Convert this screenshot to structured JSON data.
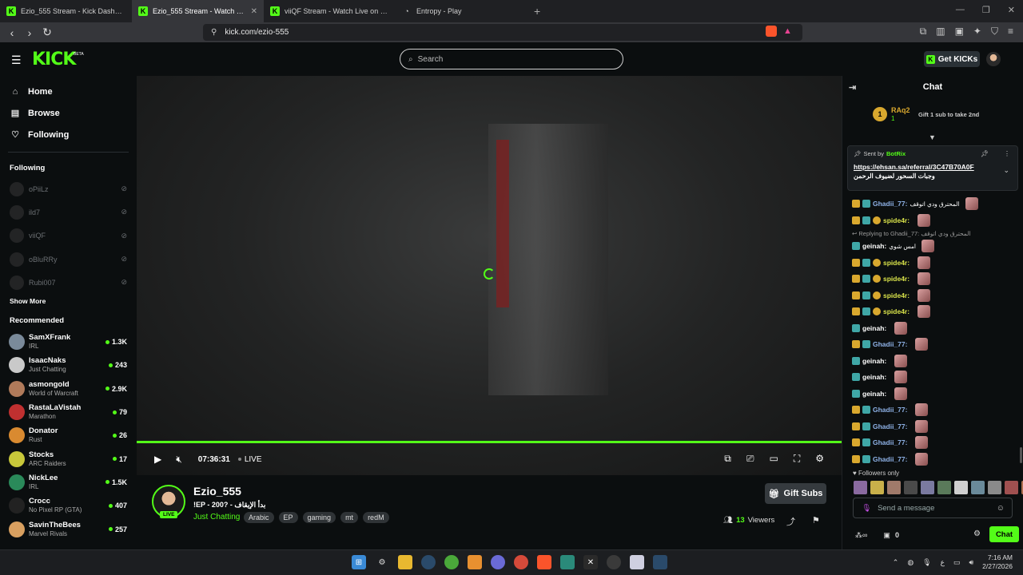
{
  "browser": {
    "tabs": [
      {
        "title": "Ezio_555 Stream - Kick Dashboard",
        "active": false,
        "icon": "kick-icon"
      },
      {
        "title": "Ezio_555 Stream - Watch Live on Kick",
        "active": true,
        "icon": "kick-icon"
      },
      {
        "title": "viiQF Stream - Watch Live on Kick",
        "active": false,
        "icon": "kick-icon"
      },
      {
        "title": "Entropy - Play",
        "active": false,
        "icon": "entropy-icon"
      }
    ],
    "url": "kick.com/ezio-555"
  },
  "header": {
    "logo": "KICK",
    "beta": "BETA",
    "search_placeholder": "Search",
    "get_kicks": "Get KICKs"
  },
  "sidebar": {
    "nav": [
      {
        "label": "Home",
        "icon": "home-icon"
      },
      {
        "label": "Browse",
        "icon": "browse-icon"
      },
      {
        "label": "Following",
        "icon": "heart-icon"
      }
    ],
    "following_title": "Following",
    "following": [
      {
        "name": "oPiiLz"
      },
      {
        "name": "ild7"
      },
      {
        "name": "viiQF"
      },
      {
        "name": "oBluRRy"
      },
      {
        "name": "Rubi007"
      }
    ],
    "show_more": "Show More",
    "recommended_title": "Recommended",
    "recommended": [
      {
        "name": "SamXFrank",
        "category": "IRL",
        "viewers": "1.3K",
        "color": "#7a8a9a"
      },
      {
        "name": "IsaacNaks",
        "category": "Just Chatting",
        "viewers": "243",
        "color": "#c9c9c9"
      },
      {
        "name": "asmongold",
        "category": "World of Warcraft",
        "viewers": "2.9K",
        "color": "#b07a5a"
      },
      {
        "name": "RastaLaVistah",
        "category": "Marathon",
        "viewers": "79",
        "color": "#c03030"
      },
      {
        "name": "Donator",
        "category": "Rust",
        "viewers": "26",
        "color": "#d98a30"
      },
      {
        "name": "Stocks",
        "category": "ARC Raiders",
        "viewers": "17",
        "color": "#c8c83a"
      },
      {
        "name": "NickLee",
        "category": "IRL",
        "viewers": "1.5K",
        "color": "#2a8a5a"
      },
      {
        "name": "Crocc",
        "category": "No Pixel RP (GTA)",
        "viewers": "407",
        "color": "#222222"
      },
      {
        "name": "SavinTheBees",
        "category": "Marvel Rivals",
        "viewers": "257",
        "color": "#d9a060"
      }
    ]
  },
  "player": {
    "time": "07:36:31",
    "live": "LIVE"
  },
  "stream": {
    "channel": "Ezio_555",
    "live_badge": "LIVE",
    "title": "!EP - 200? - بدأ الإيقاف",
    "category": "Just Chatting",
    "tags": [
      "Arabic",
      "EP",
      "gaming",
      "mt",
      "redM"
    ],
    "gift_subs": "Gift Subs",
    "viewers_count": "13",
    "viewers_label": "Viewers"
  },
  "chat": {
    "title": "Chat",
    "leader_name": "RAq2",
    "leader_count": "1",
    "leader_rank": "1",
    "gift_prompt": "Gift 1 sub to take 2nd",
    "pinned": {
      "sent_by": "Sent by",
      "bot": "BotRix",
      "link": "https://ehsan.sa/referral/3C47B70A0F",
      "text": "وجبات السحور لضيوف الرحمن"
    },
    "messages": [
      {
        "user": "Ghadii_77:",
        "color": "#8fb3e8",
        "badges": [
          "crown",
          "sub"
        ],
        "text": "المحترق ودي اتوقف"
      },
      {
        "user": "spide4r:",
        "color": "#d9e34a",
        "badges": [
          "crown",
          "sub",
          "gold"
        ],
        "text": ""
      },
      {
        "reply": "Replying to Ghadii_77: المحترق ودي اتوقف"
      },
      {
        "user": "geinah:",
        "color": "#ffffff",
        "badges": [
          "sub"
        ],
        "text": "امس شوي"
      },
      {
        "user": "spide4r:",
        "color": "#d9e34a",
        "badges": [
          "crown",
          "sub",
          "gold"
        ],
        "text": ""
      },
      {
        "user": "spide4r:",
        "color": "#d9e34a",
        "badges": [
          "crown",
          "sub",
          "gold"
        ],
        "text": ""
      },
      {
        "user": "spide4r:",
        "color": "#d9e34a",
        "badges": [
          "crown",
          "sub",
          "gold"
        ],
        "text": ""
      },
      {
        "user": "spide4r:",
        "color": "#d9e34a",
        "badges": [
          "crown",
          "sub",
          "gold"
        ],
        "text": ""
      },
      {
        "user": "geinah:",
        "color": "#ffffff",
        "badges": [
          "sub"
        ],
        "text": ""
      },
      {
        "user": "Ghadii_77:",
        "color": "#8fb3e8",
        "badges": [
          "crown",
          "sub"
        ],
        "text": ""
      },
      {
        "user": "geinah:",
        "color": "#ffffff",
        "badges": [
          "sub"
        ],
        "text": ""
      },
      {
        "user": "geinah:",
        "color": "#ffffff",
        "badges": [
          "sub"
        ],
        "text": ""
      },
      {
        "user": "geinah:",
        "color": "#ffffff",
        "badges": [
          "sub"
        ],
        "text": ""
      },
      {
        "user": "Ghadii_77:",
        "color": "#8fb3e8",
        "badges": [
          "crown",
          "sub"
        ],
        "text": ""
      },
      {
        "user": "Ghadii_77:",
        "color": "#8fb3e8",
        "badges": [
          "crown",
          "sub"
        ],
        "text": ""
      },
      {
        "user": "Ghadii_77:",
        "color": "#8fb3e8",
        "badges": [
          "crown",
          "sub"
        ],
        "text": ""
      },
      {
        "user": "Ghadii_77:",
        "color": "#8fb3e8",
        "badges": [
          "crown",
          "sub"
        ],
        "text": ""
      }
    ],
    "followers_only": "Followers only",
    "send_placeholder": "Send a message",
    "kicks_count": "0",
    "chat_button": "Chat"
  },
  "taskbar": {
    "time": "7:16 AM",
    "date": "2/27/2026"
  },
  "colors": {
    "accent": "#53fc18",
    "background": "#0b0e0f"
  }
}
